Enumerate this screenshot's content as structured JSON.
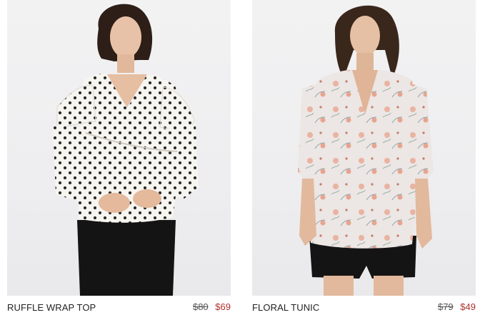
{
  "products": [
    {
      "name": "RUFFLE WRAP TOP",
      "original_price": "$80",
      "sale_price": "$69",
      "image_alt": "model-wearing-polka-dot-wrap-top"
    },
    {
      "name": "FLORAL TUNIC",
      "original_price": "$79",
      "sale_price": "$49",
      "image_alt": "model-wearing-floral-tunic"
    }
  ],
  "colors": {
    "sale_price": "#b0302b",
    "original_price": "#555555",
    "product_name": "#222222",
    "image_background": "#efeff1"
  }
}
